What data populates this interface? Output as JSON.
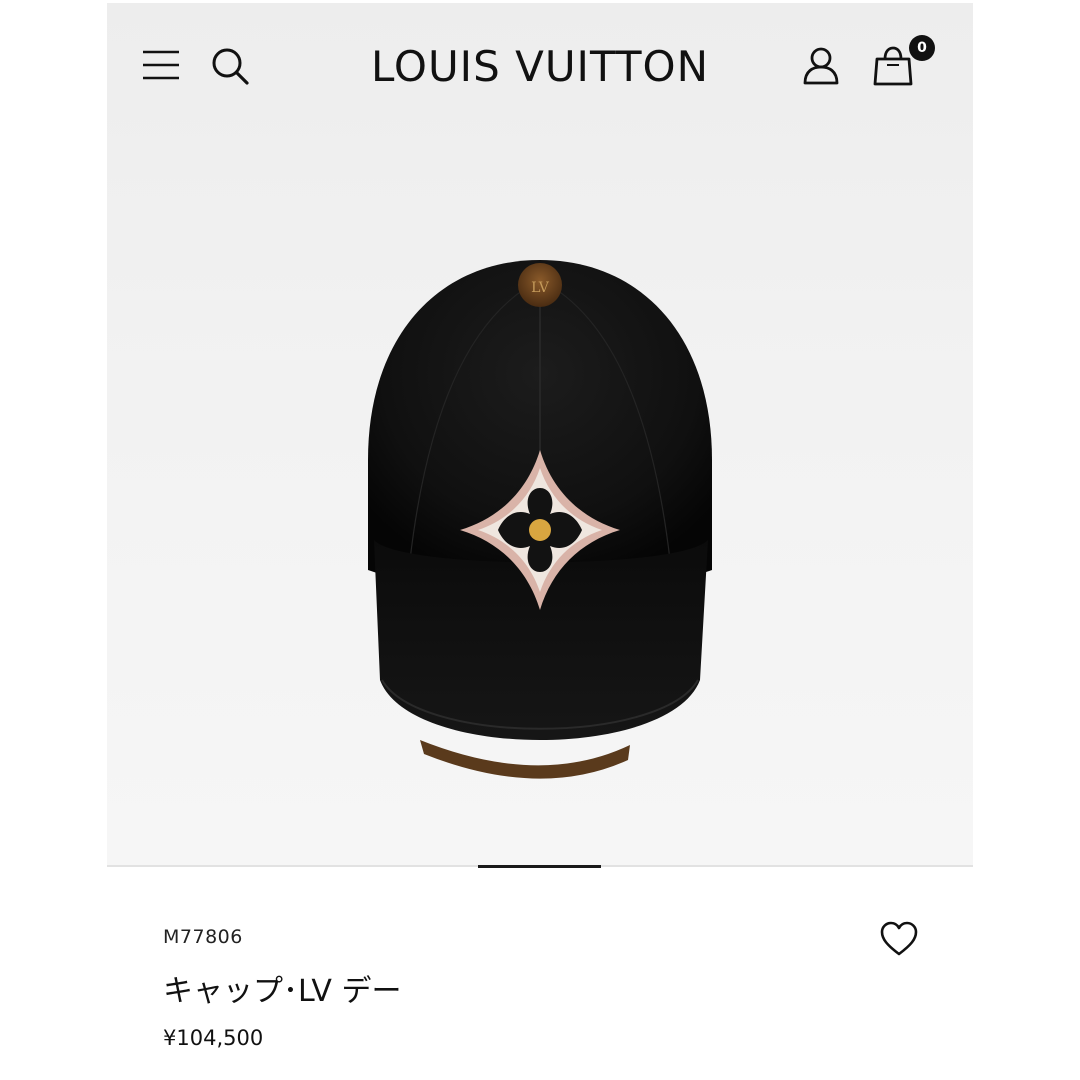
{
  "header": {
    "brand": "LOUIS VUITTON",
    "bag_count": "0",
    "icons": [
      "menu-icon",
      "search-icon",
      "account-icon",
      "shopping-bag-icon"
    ]
  },
  "product": {
    "sku": "M77806",
    "name": "キャップ･LV デー",
    "price": "¥104,500",
    "image": "black-baseball-cap-with-monogram-flower",
    "wishlist_icon": "heart-icon"
  },
  "carousel": {
    "active_index": 1
  },
  "colors": {
    "text": "#111111",
    "hero_background": "#efefef",
    "badge": "#111111"
  }
}
